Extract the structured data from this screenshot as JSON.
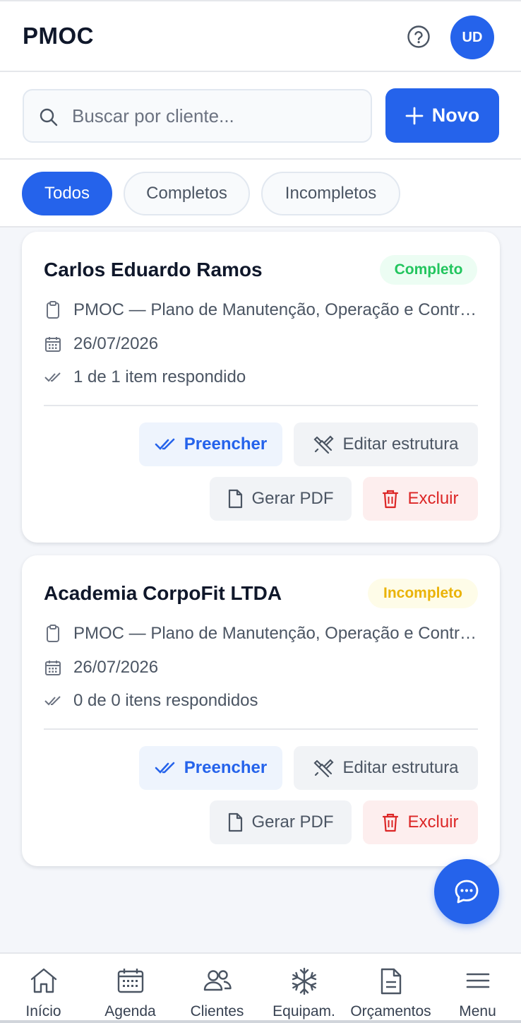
{
  "header": {
    "title": "PMOC",
    "help_icon": "help-circle-icon",
    "avatar_initials": "UD"
  },
  "search": {
    "placeholder": "Buscar por cliente...",
    "value": ""
  },
  "new_button": {
    "label": "Novo"
  },
  "filters": [
    {
      "label": "Todos",
      "active": true
    },
    {
      "label": "Completos",
      "active": false
    },
    {
      "label": "Incompletos",
      "active": false
    }
  ],
  "cards": [
    {
      "client": "Carlos Eduardo Ramos",
      "status": "Completo",
      "plan": "PMOC — Plano de Manutenção, Operação e Controle",
      "date": "26/07/2026",
      "progress": "1 de 1 item respondido",
      "actions": {
        "fill": "Preencher",
        "edit": "Editar estrutura",
        "pdf": "Gerar PDF",
        "delete": "Excluir"
      }
    },
    {
      "client": "Academia CorpoFit LTDA",
      "status": "Incompleto",
      "plan": "PMOC — Plano de Manutenção, Operação e Controle",
      "date": "26/07/2026",
      "progress": "0 de 0 itens respondidos",
      "actions": {
        "fill": "Preencher",
        "edit": "Editar estrutura",
        "pdf": "Gerar PDF",
        "delete": "Excluir"
      }
    }
  ],
  "bottom_nav": [
    {
      "label": "Início",
      "icon": "home-icon"
    },
    {
      "label": "Agenda",
      "icon": "calendar-icon"
    },
    {
      "label": "Clientes",
      "icon": "users-icon"
    },
    {
      "label": "Equipam.",
      "icon": "snowflake-icon"
    },
    {
      "label": "Orçamentos",
      "icon": "document-icon"
    },
    {
      "label": "Menu",
      "icon": "menu-icon"
    }
  ],
  "colors": {
    "primary": "#2563eb",
    "success": "#22c55e",
    "warning": "#eab308",
    "danger": "#dc2626"
  }
}
